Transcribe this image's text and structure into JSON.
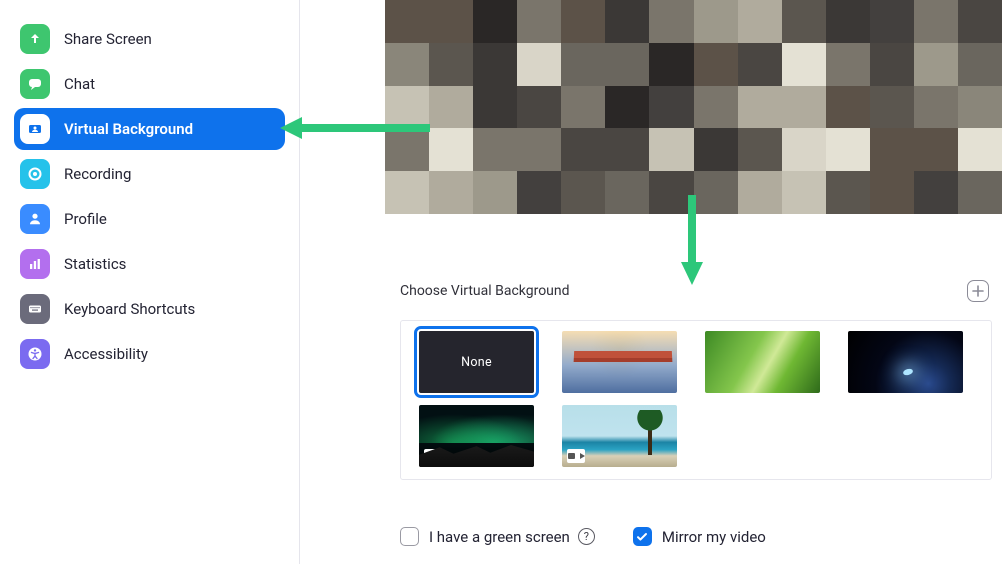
{
  "sidebar": {
    "items": [
      {
        "id": "share-screen",
        "label": "Share Screen",
        "icon": "share-screen-icon",
        "icon_bg": "#3ec66f"
      },
      {
        "id": "chat",
        "label": "Chat",
        "icon": "chat-icon",
        "icon_bg": "#3ec66f"
      },
      {
        "id": "virtual-bg",
        "label": "Virtual Background",
        "icon": "virtual-background-icon",
        "icon_bg": "#0e72ec",
        "active": true
      },
      {
        "id": "recording",
        "label": "Recording",
        "icon": "recording-icon",
        "icon_bg": "#25c2ea"
      },
      {
        "id": "profile",
        "label": "Profile",
        "icon": "profile-icon",
        "icon_bg": "#3a8cff"
      },
      {
        "id": "statistics",
        "label": "Statistics",
        "icon": "statistics-icon",
        "icon_bg": "#b36fee"
      },
      {
        "id": "keyboard",
        "label": "Keyboard Shortcuts",
        "icon": "keyboard-icon",
        "icon_bg": "#6b6b7b"
      },
      {
        "id": "accessibility",
        "label": "Accessibility",
        "icon": "accessibility-icon",
        "icon_bg": "#7b6bf0"
      }
    ]
  },
  "main": {
    "section_title": "Choose Virtual Background",
    "backgrounds": [
      {
        "id": "none",
        "label": "None",
        "selected": true
      },
      {
        "id": "bridge"
      },
      {
        "id": "grass"
      },
      {
        "id": "earth"
      },
      {
        "id": "aurora",
        "has_video_badge": true
      },
      {
        "id": "beach",
        "has_video_badge": true
      }
    ],
    "checkboxes": {
      "green_screen": {
        "label": "I have a green screen",
        "checked": false
      },
      "mirror": {
        "label": "Mirror my video",
        "checked": true
      }
    },
    "add_button_tooltip": "+"
  },
  "accent_color": "#0e72ec"
}
